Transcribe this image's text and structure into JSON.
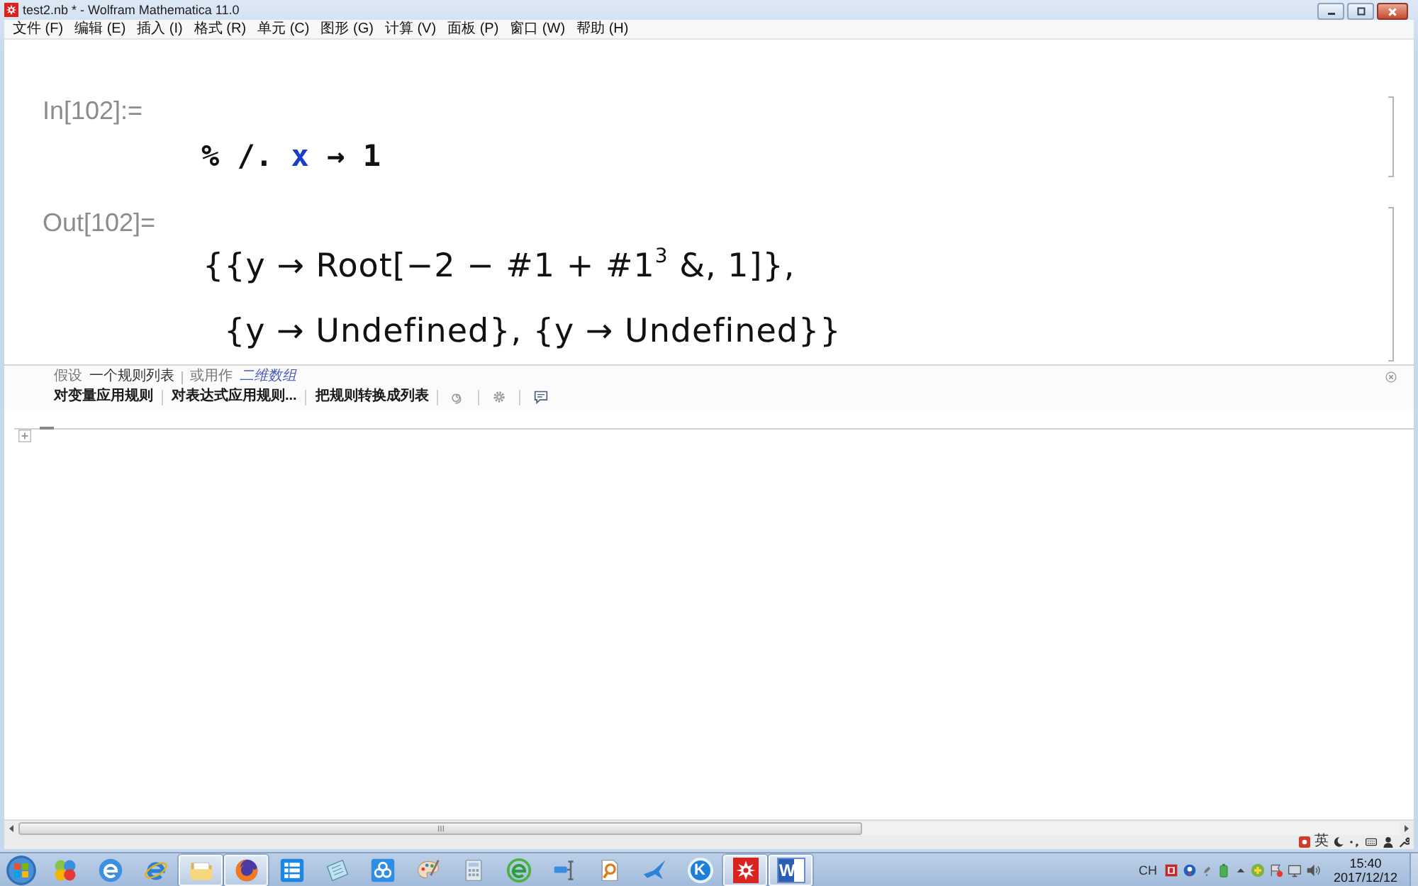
{
  "window": {
    "title": "test2.nb * - Wolfram Mathematica 11.0"
  },
  "menu": [
    "文件 (F)",
    "编辑 (E)",
    "插入 (I)",
    "格式 (R)",
    "单元 (C)",
    "图形 (G)",
    "计算 (V)",
    "面板 (P)",
    "窗口 (W)",
    "帮助 (H)"
  ],
  "cells": [
    {
      "kind": "input",
      "label": "In[102]:=",
      "tokens": [
        {
          "kind": "operator",
          "text": "% /."
        },
        {
          "kind": "symbol",
          "text": "x"
        },
        {
          "kind": "operator",
          "text": "→ 1"
        }
      ]
    },
    {
      "kind": "output",
      "label": "Out[102]=",
      "lines": [
        "{{y → Root[−2 − #1 + #1$^{3}$ &, 1]},",
        "{y → Undefined}, {y → Undefined}}"
      ]
    }
  ],
  "suggestions_bar": {
    "assuming_label": "假设",
    "assuming_value": "一个规则列表",
    "alternative_label": "或用作",
    "alternative_link": "二维数组",
    "buttons": [
      "对变量应用规则",
      "对表达式应用规则...",
      "把规则转换成列表"
    ]
  },
  "status_bar": {
    "input_mode": "英"
  },
  "taskbar": {
    "apps": [
      {
        "open": false
      },
      {
        "open": false
      },
      {
        "open": false
      },
      {
        "open": true
      },
      {
        "open": true
      },
      {
        "open": false
      },
      {
        "open": false
      },
      {
        "open": false
      },
      {
        "open": false
      },
      {
        "open": false
      },
      {
        "open": false
      },
      {
        "open": false
      },
      {
        "open": false
      },
      {
        "open": false
      },
      {
        "open": false,
        "glyph": "K"
      },
      {
        "open": true
      },
      {
        "open": true,
        "glyph": "W"
      }
    ],
    "language": "CH",
    "time": "15:40",
    "date": "2017/12/12"
  }
}
